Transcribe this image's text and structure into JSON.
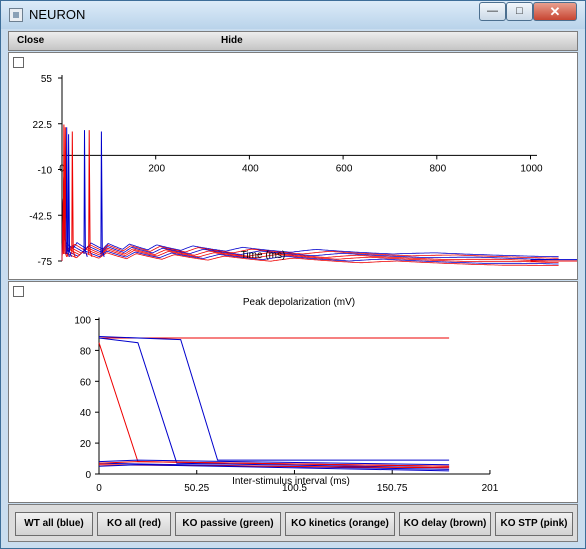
{
  "window": {
    "title": "NEURON",
    "min_glyph": "—",
    "max_glyph": "□",
    "close_glyph": "✕"
  },
  "menu": {
    "close_label": "Close",
    "hide_label": "Hide"
  },
  "top_plot": {
    "x_axis_label": "Time (ms)",
    "x_ticks": [
      "0",
      "200",
      "400",
      "600",
      "800",
      "1000"
    ],
    "y_ticks": [
      "55",
      "22.5",
      "-10",
      "-42.5",
      "-75"
    ]
  },
  "bottom_plot": {
    "title": "Peak depolarization (mV)",
    "x_axis_label": "Inter-stimulus interval (ms)",
    "x_ticks": [
      "0",
      "50.25",
      "100.5",
      "150.75",
      "201"
    ],
    "y_ticks": [
      "100",
      "80",
      "60",
      "40",
      "20",
      "0"
    ]
  },
  "buttons": [
    {
      "label": "WT all (blue)"
    },
    {
      "label": "KO all (red)"
    },
    {
      "label": "KO passive (green)"
    },
    {
      "label": "KO kinetics (orange)"
    },
    {
      "label": "KO delay (brown)"
    },
    {
      "label": "KO STP (pink)"
    }
  ],
  "colors": {
    "blue_trace": "#0000cc",
    "red_trace": "#ee0000"
  },
  "chart_data": [
    {
      "type": "line",
      "title": "",
      "xlabel": "Time (ms)",
      "ylabel": "",
      "xlim": [
        0,
        1100
      ],
      "ylim": [
        -75,
        55
      ],
      "series": [
        {
          "color": "blue",
          "x": [
            0,
            5,
            8,
            12,
            20,
            30,
            35,
            40,
            60,
            120,
            200,
            300,
            400,
            500,
            600,
            700,
            800,
            900,
            1000,
            1100
          ],
          "y": [
            -75,
            20,
            -65,
            -70,
            -67,
            20,
            -60,
            -72,
            -70,
            -72,
            -71,
            -72,
            -72,
            -72,
            -72,
            -73,
            -73,
            -73,
            -74,
            -74
          ]
        },
        {
          "color": "red",
          "x": [
            0,
            5,
            8,
            12,
            20,
            30,
            35,
            40,
            60,
            120,
            200,
            300,
            400,
            500,
            600,
            700,
            800,
            900,
            1000,
            1100
          ],
          "y": [
            -75,
            22,
            -62,
            -71,
            -69,
            20,
            -58,
            -73,
            -71,
            -73,
            -72,
            -73,
            -73,
            -73,
            -73,
            -74,
            -74,
            -74,
            -75,
            -75
          ]
        }
      ]
    },
    {
      "type": "line",
      "title": "Peak depolarization (mV)",
      "xlabel": "Inter-stimulus interval (ms)",
      "ylabel": "",
      "xlim": [
        0,
        201
      ],
      "ylim": [
        0,
        100
      ],
      "series": [
        {
          "color": "red",
          "x": [
            0,
            180
          ],
          "y": [
            88,
            88
          ]
        },
        {
          "color": "red",
          "x": [
            0,
            20,
            180
          ],
          "y": [
            85,
            8,
            5
          ]
        },
        {
          "color": "blue",
          "x": [
            0,
            20,
            40,
            180
          ],
          "y": [
            88,
            85,
            7,
            4
          ]
        },
        {
          "color": "blue",
          "x": [
            0,
            42,
            61,
            180
          ],
          "y": [
            89,
            87,
            9,
            9
          ]
        },
        {
          "color": "blue",
          "x": [
            0,
            180
          ],
          "y": [
            7,
            3
          ]
        },
        {
          "color": "red",
          "x": [
            0,
            180
          ],
          "y": [
            6,
            4
          ]
        }
      ]
    }
  ]
}
